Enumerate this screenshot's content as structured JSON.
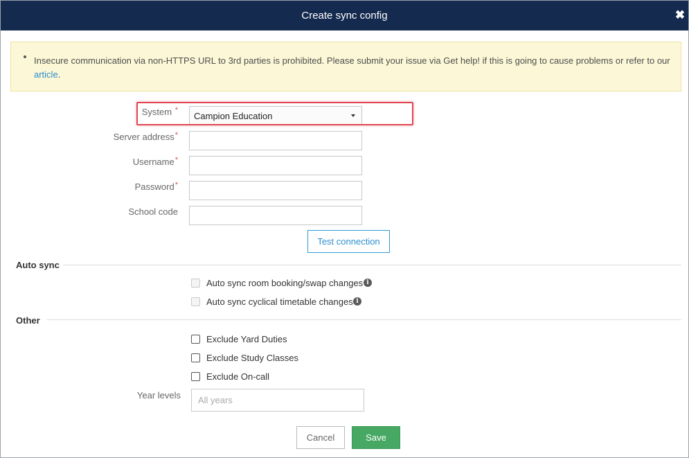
{
  "header": {
    "title": "Create sync config",
    "close_glyph": "✖"
  },
  "alert": {
    "text": "Insecure communication via non-HTTPS URL to 3rd parties is prohibited. Please submit your issue via Get help! if this is going to cause problems or refer to our ",
    "link_text": "article",
    "suffix": "."
  },
  "form": {
    "required_mark": "*",
    "system": {
      "label": "System",
      "value": "Campion Education"
    },
    "server_address": {
      "label": "Server address",
      "value": ""
    },
    "username": {
      "label": "Username",
      "value": ""
    },
    "password": {
      "label": "Password",
      "value": ""
    },
    "school_code": {
      "label": "School code",
      "value": ""
    },
    "test_connection_label": "Test connection"
  },
  "auto_sync": {
    "title": "Auto sync",
    "items": [
      {
        "label": "Auto sync room booking/swap changes",
        "checked": false,
        "disabled": true,
        "icon": "info-icon"
      },
      {
        "label": "Auto sync cyclical timetable changes",
        "checked": false,
        "disabled": true,
        "icon": "info-icon"
      }
    ]
  },
  "other": {
    "title": "Other",
    "items": [
      {
        "label": "Exclude Yard Duties",
        "checked": false
      },
      {
        "label": "Exclude Study Classes",
        "checked": false
      },
      {
        "label": "Exclude On-call",
        "checked": false
      }
    ],
    "year_levels": {
      "label": "Year levels",
      "placeholder": "All years",
      "value": ""
    }
  },
  "footer": {
    "cancel_label": "Cancel",
    "save_label": "Save"
  },
  "colors": {
    "header_bg": "#152a4f",
    "alert_bg": "#fcf8d7",
    "link": "#2a8bc9",
    "required": "#d9534f",
    "save_bg": "#47a863",
    "highlight_border": "#e0454f"
  }
}
